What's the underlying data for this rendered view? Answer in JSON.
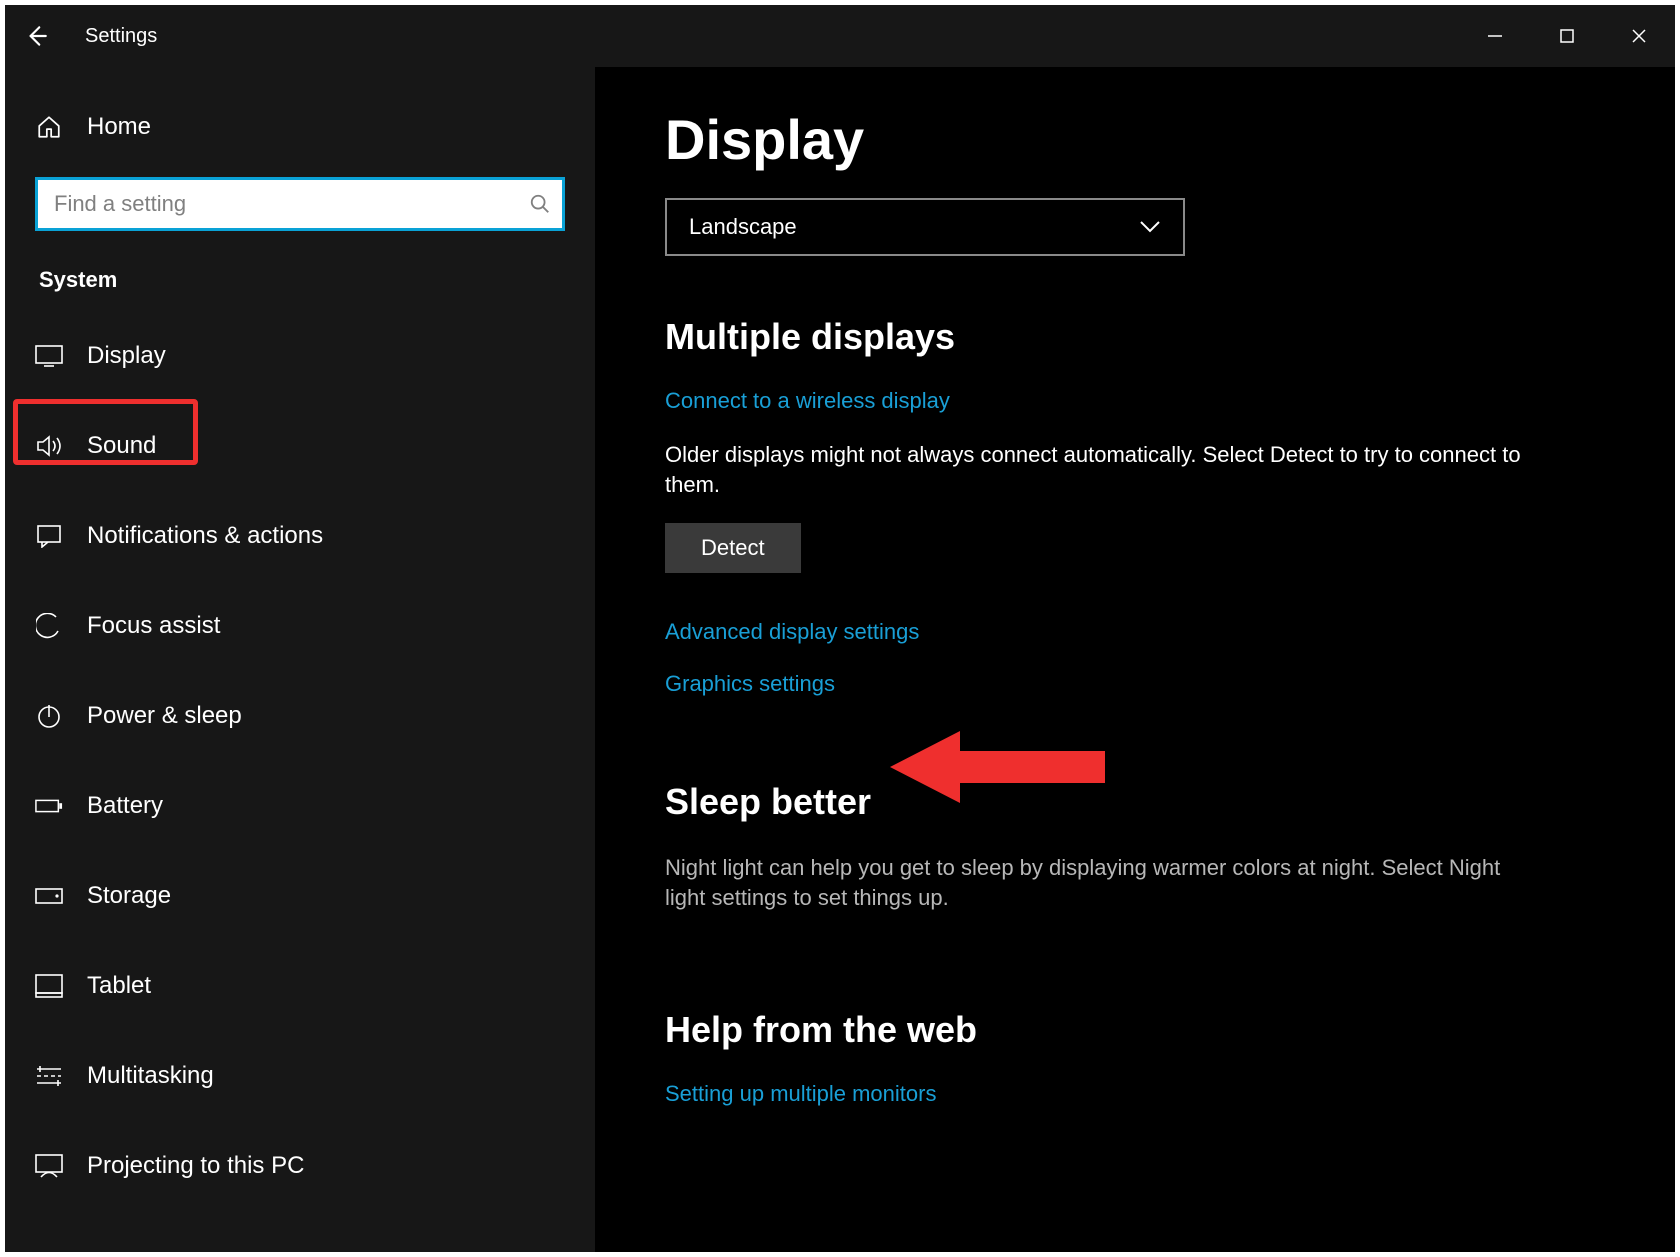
{
  "titlebar": {
    "title": "Settings"
  },
  "sidebar": {
    "home_label": "Home",
    "search_placeholder": "Find a setting",
    "section_label": "System",
    "items": [
      {
        "label": "Display",
        "active": true
      },
      {
        "label": "Sound"
      },
      {
        "label": "Notifications & actions"
      },
      {
        "label": "Focus assist"
      },
      {
        "label": "Power & sleep"
      },
      {
        "label": "Battery"
      },
      {
        "label": "Storage"
      },
      {
        "label": "Tablet"
      },
      {
        "label": "Multitasking"
      },
      {
        "label": "Projecting to this PC"
      }
    ]
  },
  "main": {
    "page_title": "Display",
    "dropdown_value": "Landscape",
    "multiple_displays": {
      "heading": "Multiple displays",
      "connect_link": "Connect to a wireless display",
      "detect_hint": "Older displays might not always connect automatically. Select Detect to try to connect to them.",
      "detect_button": "Detect",
      "advanced_link": "Advanced display settings",
      "graphics_link": "Graphics settings"
    },
    "sleep_better": {
      "heading": "Sleep better",
      "para": "Night light can help you get to sleep by displaying warmer colors at night. Select Night light settings to set things up."
    },
    "help": {
      "heading": "Help from the web",
      "link": "Setting up multiple monitors"
    }
  }
}
